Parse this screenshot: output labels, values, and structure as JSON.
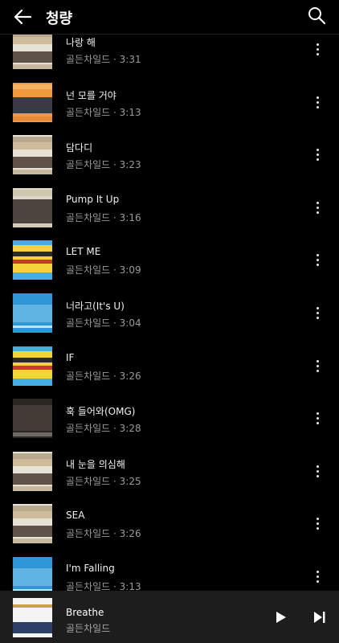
{
  "header": {
    "title": "청량"
  },
  "tracks": [
    {
      "title": "나랑 해",
      "artist": "골든차일드",
      "duration": "3:31",
      "art": "house"
    },
    {
      "title": "넌 모를 거야",
      "artist": "골든차일드",
      "duration": "3:13",
      "art": "orange"
    },
    {
      "title": "담다디",
      "artist": "골든차일드",
      "duration": "3:23",
      "art": "house"
    },
    {
      "title": "Pump It Up",
      "artist": "골든차일드",
      "duration": "3:16",
      "art": "beige"
    },
    {
      "title": "LET ME",
      "artist": "골든차일드",
      "duration": "3:09",
      "art": "yellow"
    },
    {
      "title": "너라고(It's U)",
      "artist": "골든차일드",
      "duration": "3:04",
      "art": "blue"
    },
    {
      "title": "IF",
      "artist": "골든차일드",
      "duration": "3:26",
      "art": "yellow"
    },
    {
      "title": "훅 들어와(OMG)",
      "artist": "골든차일드",
      "duration": "3:28",
      "art": "dark"
    },
    {
      "title": "내 눈을 의심해",
      "artist": "골든차일드",
      "duration": "3:25",
      "art": "house"
    },
    {
      "title": "SEA",
      "artist": "골든차일드",
      "duration": "3:26",
      "art": "house"
    },
    {
      "title": "I'm Falling",
      "artist": "골든차일드",
      "duration": "3:13",
      "art": "blue"
    }
  ],
  "separator": " · ",
  "now_playing": {
    "title": "Breathe",
    "artist": "골든차일드"
  },
  "colors": {
    "background": "#000000",
    "player": "#1d1d1d",
    "secondary_text": "#9a9a9a"
  },
  "icons": {
    "back": "arrow-left",
    "search": "magnifier",
    "more": "vertical-dots",
    "play": "play-triangle",
    "next": "skip-next"
  }
}
